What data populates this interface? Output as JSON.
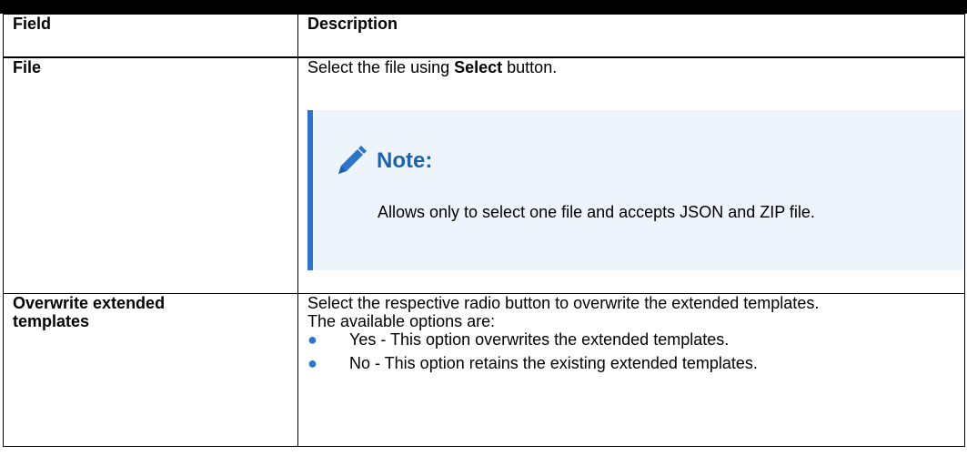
{
  "table": {
    "headers": [
      "Field",
      "Description"
    ],
    "rows": [
      {
        "field": "File",
        "desc_prefix": "Select the file using ",
        "desc_bold": "Select",
        "desc_suffix": " button.",
        "note": {
          "icon": "pencil-icon",
          "title": "Note:",
          "body": "Allows only to select one file and accepts JSON and ZIP file."
        }
      },
      {
        "field": "Overwrite extended templates",
        "desc_line1": "Select the respective radio button to overwrite the extended templates.",
        "desc_line2": "The available options are:",
        "options": [
          "Yes - This option overwrites the extended templates.",
          "No - This option retains the existing extended templates."
        ]
      }
    ]
  },
  "colors": {
    "accent": "#2e74c9",
    "note_bg": "#eef4fb",
    "note_title": "#1d62ad"
  }
}
